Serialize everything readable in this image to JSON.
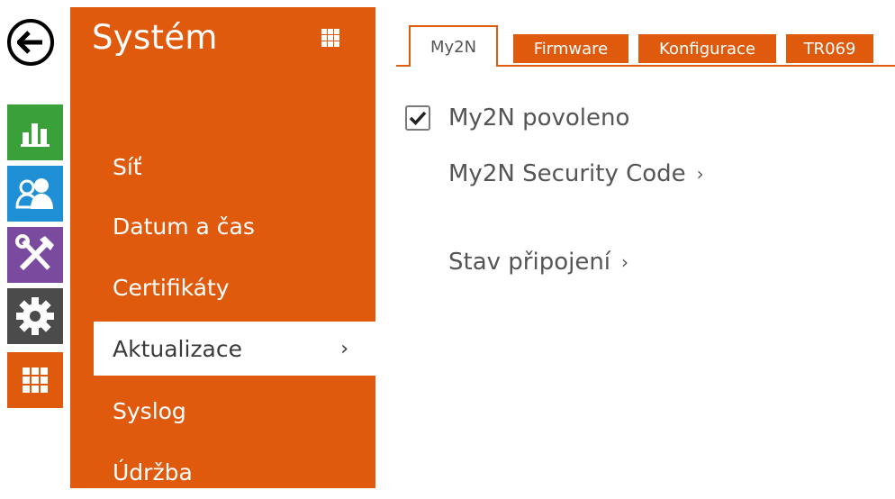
{
  "rail": {
    "back_icon": "arrow-left-icon",
    "items": [
      {
        "name": "status",
        "icon": "bar-chart-icon",
        "color": "#3aa13a"
      },
      {
        "name": "users",
        "icon": "users-icon",
        "color": "#1f8fd6"
      },
      {
        "name": "services",
        "icon": "tools-icon",
        "color": "#7a4a9e"
      },
      {
        "name": "hardware",
        "icon": "gear-icon",
        "color": "#4b4b4b"
      },
      {
        "name": "system",
        "icon": "grid-icon",
        "color": "#e05a0d"
      }
    ]
  },
  "menu": {
    "title": "Systém",
    "grid_icon": "grid-icon",
    "items": [
      {
        "label": "Síť"
      },
      {
        "label": "Datum a čas"
      },
      {
        "label": "Certifikáty"
      },
      {
        "label": "Aktualizace",
        "active": true
      },
      {
        "label": "Syslog"
      },
      {
        "label": "Údržba"
      }
    ],
    "active_chevron": "›"
  },
  "tabs": [
    {
      "label": "My2N",
      "active": true
    },
    {
      "label": "Firmware"
    },
    {
      "label": "Konfigurace"
    },
    {
      "label": "TR069"
    }
  ],
  "content": {
    "enable": {
      "label": "My2N povoleno",
      "checked": true
    },
    "security_code": {
      "label": "My2N Security Code",
      "chevron": "›"
    },
    "connection_state": {
      "label": "Stav připojení",
      "chevron": "›"
    }
  },
  "colors": {
    "accent": "#e05a0d",
    "text": "#555555"
  }
}
